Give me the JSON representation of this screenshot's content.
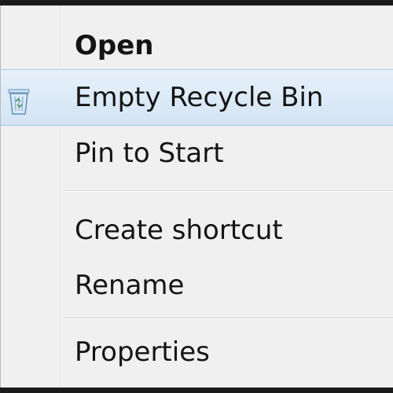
{
  "context_menu": {
    "items": [
      {
        "label": "Open",
        "bold": true
      },
      {
        "label": "Empty Recycle Bin",
        "icon": "recycle-bin-icon",
        "highlighted": true
      },
      {
        "label": "Pin to Start"
      },
      {
        "label": "Create shortcut"
      },
      {
        "label": "Rename"
      },
      {
        "label": "Properties"
      }
    ]
  },
  "colors": {
    "menu_background": "#f0f0f0",
    "highlight_top": "#e6f0fa",
    "highlight_bottom": "#d4e4f4",
    "highlight_border": "#a9c6e6",
    "text": "#141414"
  }
}
